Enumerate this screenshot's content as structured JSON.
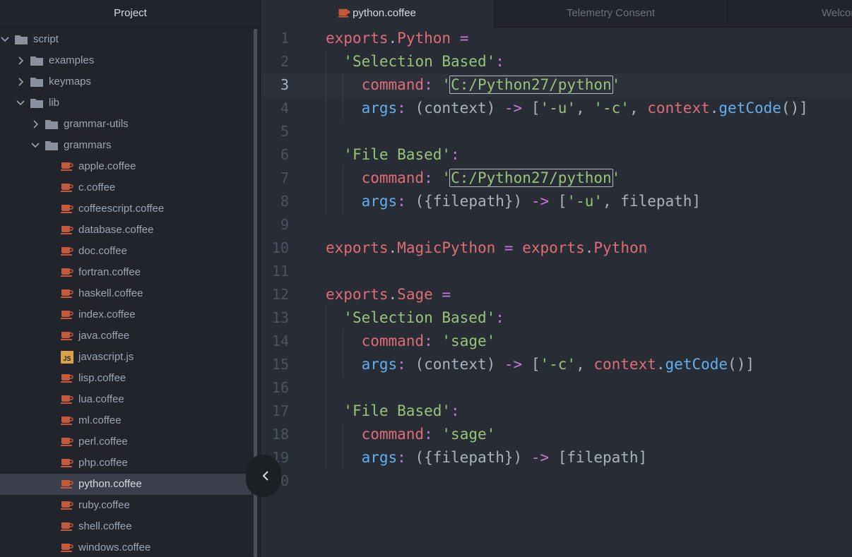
{
  "tree": {
    "title": "Project",
    "items": [
      {
        "label": "script",
        "type": "folder",
        "level": 0,
        "expanded": true
      },
      {
        "label": "examples",
        "type": "folder",
        "level": 1,
        "expanded": false
      },
      {
        "label": "keymaps",
        "type": "folder",
        "level": 1,
        "expanded": false
      },
      {
        "label": "lib",
        "type": "folder",
        "level": 1,
        "expanded": true
      },
      {
        "label": "grammar-utils",
        "type": "folder",
        "level": 2,
        "expanded": false
      },
      {
        "label": "grammars",
        "type": "folder",
        "level": 2,
        "expanded": true
      },
      {
        "label": "apple.coffee",
        "type": "coffee",
        "level": 3
      },
      {
        "label": "c.coffee",
        "type": "coffee",
        "level": 3
      },
      {
        "label": "coffeescript.coffee",
        "type": "coffee",
        "level": 3
      },
      {
        "label": "database.coffee",
        "type": "coffee",
        "level": 3
      },
      {
        "label": "doc.coffee",
        "type": "coffee",
        "level": 3
      },
      {
        "label": "fortran.coffee",
        "type": "coffee",
        "level": 3
      },
      {
        "label": "haskell.coffee",
        "type": "coffee",
        "level": 3
      },
      {
        "label": "index.coffee",
        "type": "coffee",
        "level": 3
      },
      {
        "label": "java.coffee",
        "type": "coffee",
        "level": 3
      },
      {
        "label": "javascript.js",
        "type": "js",
        "level": 3
      },
      {
        "label": "lisp.coffee",
        "type": "coffee",
        "level": 3
      },
      {
        "label": "lua.coffee",
        "type": "coffee",
        "level": 3
      },
      {
        "label": "ml.coffee",
        "type": "coffee",
        "level": 3
      },
      {
        "label": "perl.coffee",
        "type": "coffee",
        "level": 3
      },
      {
        "label": "php.coffee",
        "type": "coffee",
        "level": 3
      },
      {
        "label": "python.coffee",
        "type": "coffee",
        "level": 3,
        "selected": true
      },
      {
        "label": "ruby.coffee",
        "type": "coffee",
        "level": 3
      },
      {
        "label": "shell.coffee",
        "type": "coffee",
        "level": 3
      },
      {
        "label": "windows.coffee",
        "type": "coffee",
        "level": 3
      }
    ]
  },
  "tabs": [
    {
      "label": "python.coffee",
      "active": true,
      "icon": "coffee-icon"
    },
    {
      "label": "Telemetry Consent",
      "active": false
    },
    {
      "label": "Welcome",
      "active": false
    }
  ],
  "editor": {
    "current_line": 3,
    "lines": [
      [
        [
          "v",
          "exports"
        ],
        [
          "p",
          "."
        ],
        [
          "v",
          "Python"
        ],
        [
          "p",
          " "
        ],
        [
          "o",
          "="
        ]
      ],
      [
        [
          "p",
          "  "
        ],
        [
          "s",
          "'Selection Based'"
        ],
        [
          "o",
          ":"
        ]
      ],
      [
        [
          "p",
          "    "
        ],
        [
          "v",
          "command"
        ],
        [
          "o",
          ":"
        ],
        [
          "p",
          " "
        ],
        [
          "s",
          "'"
        ],
        [
          "sb",
          "C:/Python27/python"
        ],
        [
          "s",
          "'"
        ]
      ],
      [
        [
          "p",
          "    "
        ],
        [
          "k",
          "args"
        ],
        [
          "o",
          ":"
        ],
        [
          "p",
          " (context) "
        ],
        [
          "o",
          "->"
        ],
        [
          "p",
          " ["
        ],
        [
          "s",
          "'-u'"
        ],
        [
          "p",
          ", "
        ],
        [
          "s",
          "'-c'"
        ],
        [
          "p",
          ", "
        ],
        [
          "v",
          "context"
        ],
        [
          "p",
          "."
        ],
        [
          "k",
          "getCode"
        ],
        [
          "p",
          "()]"
        ]
      ],
      [],
      [
        [
          "p",
          "  "
        ],
        [
          "s",
          "'File Based'"
        ],
        [
          "o",
          ":"
        ]
      ],
      [
        [
          "p",
          "    "
        ],
        [
          "v",
          "command"
        ],
        [
          "o",
          ":"
        ],
        [
          "p",
          " "
        ],
        [
          "s",
          "'"
        ],
        [
          "sb",
          "C:/Python27/python"
        ],
        [
          "s",
          "'"
        ]
      ],
      [
        [
          "p",
          "    "
        ],
        [
          "k",
          "args"
        ],
        [
          "o",
          ":"
        ],
        [
          "p",
          " ({filepath}) "
        ],
        [
          "o",
          "->"
        ],
        [
          "p",
          " ["
        ],
        [
          "s",
          "'-u'"
        ],
        [
          "p",
          ", filepath]"
        ]
      ],
      [],
      [
        [
          "v",
          "exports"
        ],
        [
          "p",
          "."
        ],
        [
          "v",
          "MagicPython"
        ],
        [
          "p",
          " "
        ],
        [
          "o",
          "="
        ],
        [
          "p",
          " "
        ],
        [
          "v",
          "exports"
        ],
        [
          "p",
          "."
        ],
        [
          "v",
          "Python"
        ]
      ],
      [],
      [
        [
          "v",
          "exports"
        ],
        [
          "p",
          "."
        ],
        [
          "v",
          "Sage"
        ],
        [
          "p",
          " "
        ],
        [
          "o",
          "="
        ]
      ],
      [
        [
          "p",
          "  "
        ],
        [
          "s",
          "'Selection Based'"
        ],
        [
          "o",
          ":"
        ]
      ],
      [
        [
          "p",
          "    "
        ],
        [
          "v",
          "command"
        ],
        [
          "o",
          ":"
        ],
        [
          "p",
          " "
        ],
        [
          "s",
          "'sage'"
        ]
      ],
      [
        [
          "p",
          "    "
        ],
        [
          "k",
          "args"
        ],
        [
          "o",
          ":"
        ],
        [
          "p",
          " (context) "
        ],
        [
          "o",
          "->"
        ],
        [
          "p",
          " ["
        ],
        [
          "s",
          "'-c'"
        ],
        [
          "p",
          ", "
        ],
        [
          "v",
          "context"
        ],
        [
          "p",
          "."
        ],
        [
          "k",
          "getCode"
        ],
        [
          "p",
          "()]"
        ]
      ],
      [],
      [
        [
          "p",
          "  "
        ],
        [
          "s",
          "'File Based'"
        ],
        [
          "o",
          ":"
        ]
      ],
      [
        [
          "p",
          "    "
        ],
        [
          "v",
          "command"
        ],
        [
          "o",
          ":"
        ],
        [
          "p",
          " "
        ],
        [
          "s",
          "'sage'"
        ]
      ],
      [
        [
          "p",
          "    "
        ],
        [
          "k",
          "args"
        ],
        [
          "o",
          ":"
        ],
        [
          "p",
          " ({filepath}) "
        ],
        [
          "o",
          "->"
        ],
        [
          "p",
          " [filepath]"
        ]
      ],
      []
    ]
  },
  "colors": {
    "background": "#282c34",
    "sidebar": "#21252b",
    "variable": "#e06c75",
    "string": "#98c379",
    "function": "#61afef",
    "operator": "#c678dd",
    "coffee_icon": "#c2593a"
  }
}
